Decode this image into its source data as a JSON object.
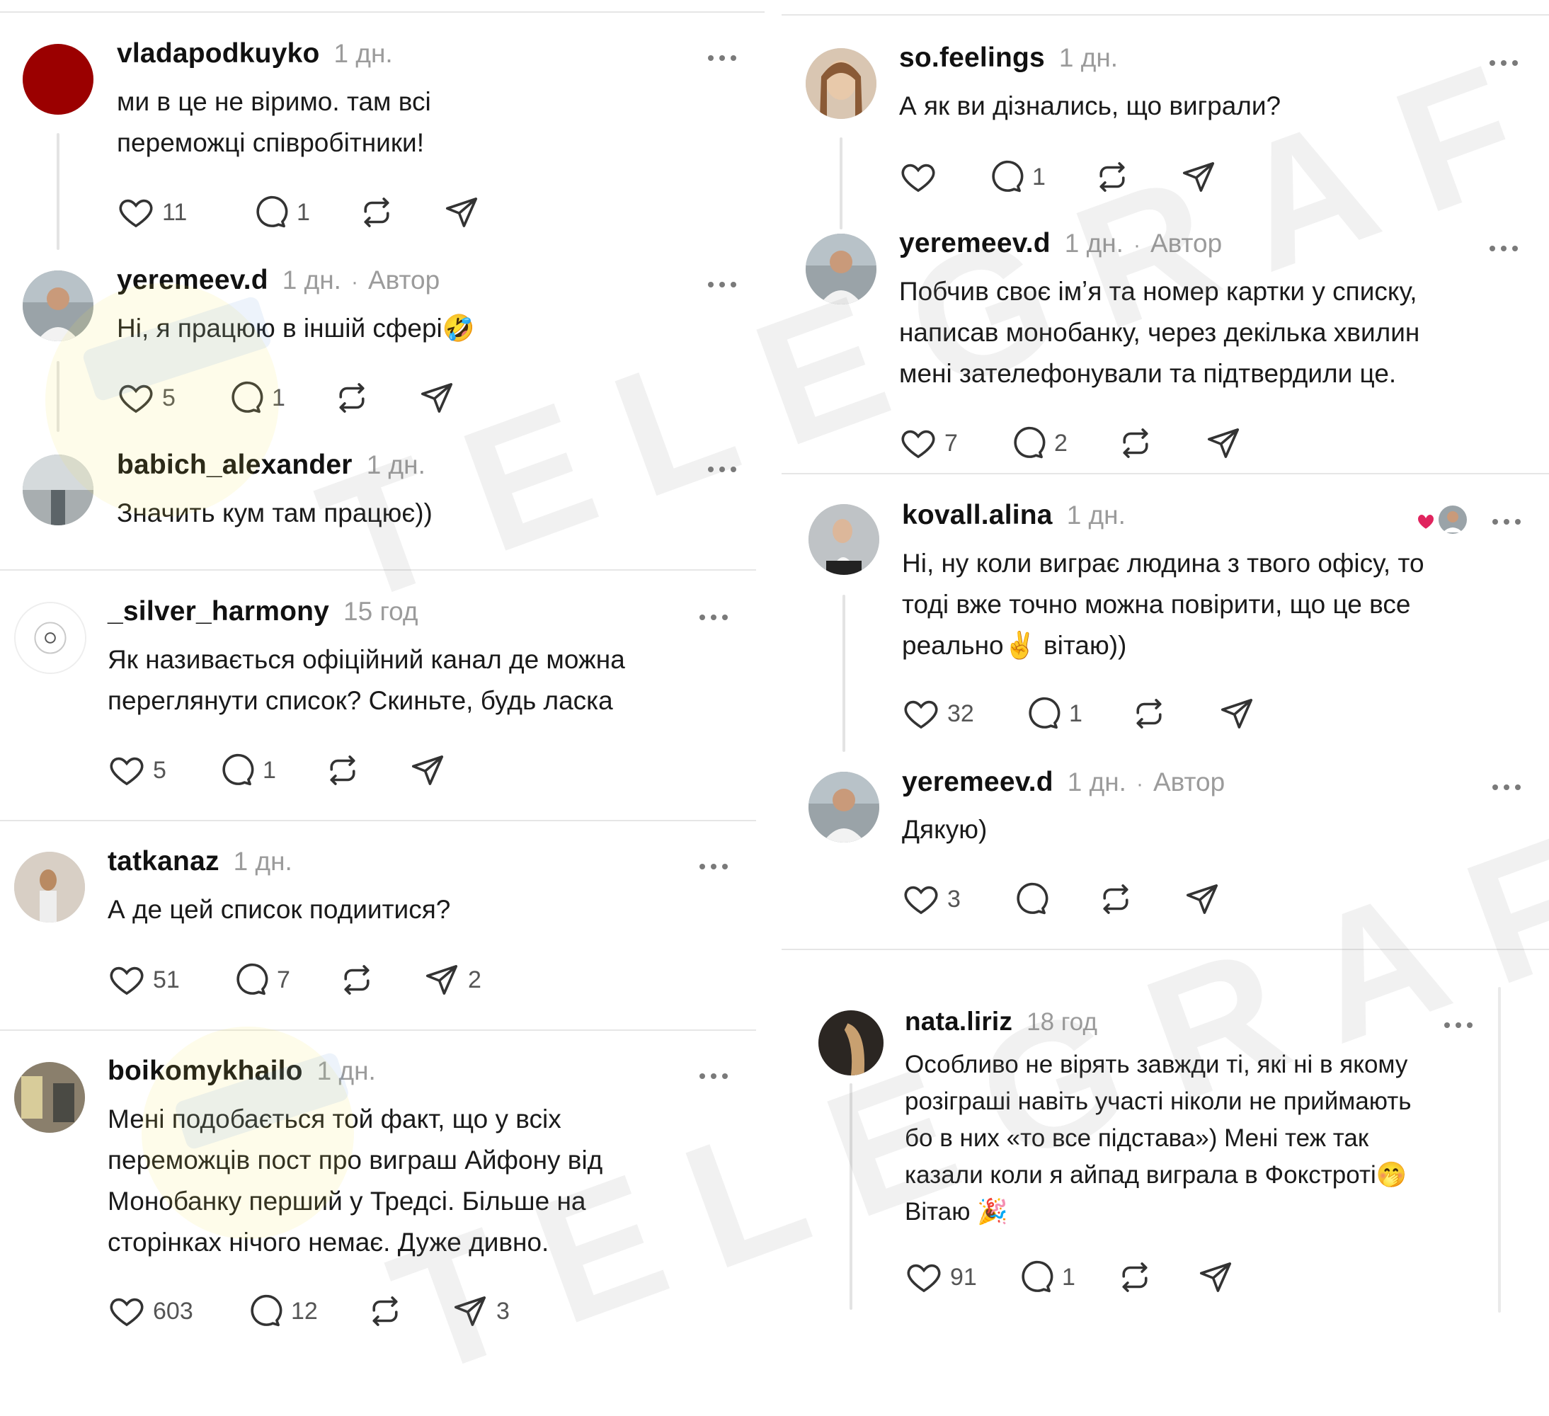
{
  "watermark": {
    "text": "TELEGRAF"
  },
  "icons": {
    "like": "heart-icon",
    "reply": "speech-bubble-icon",
    "repost": "repost-icon",
    "share": "paper-plane-icon",
    "more": "more-dots-icon"
  },
  "colors": {
    "text": "#1a1a1a",
    "muted": "#9b9b9b",
    "divider": "#e6e6e6",
    "heart": "#e0245e"
  },
  "left": [
    {
      "username": "vladapodkuyko",
      "time": "1 дн.",
      "author": "",
      "text": "ми в це не віримо. там всі\nпереможці співробітники!",
      "likes": "11",
      "replies": "1",
      "reposts": "",
      "shares": ""
    },
    {
      "username": "yeremeev.d",
      "time": "1 дн.",
      "author": "Автор",
      "text": "Ні, я працюю в іншій сфері🤣",
      "likes": "5",
      "replies": "1",
      "reposts": "",
      "shares": ""
    },
    {
      "username": "babich_alexander",
      "time": "1 дн.",
      "author": "",
      "text": "Значить кум там працює))",
      "likes": "",
      "replies": "",
      "reposts": "",
      "shares": ""
    },
    {
      "username": "_silver_harmony",
      "time": "15 год",
      "author": "",
      "text": "Як називається офіційний канал де можна\nпереглянути список? Скиньте, будь ласка",
      "likes": "5",
      "replies": "1",
      "reposts": "",
      "shares": ""
    },
    {
      "username": "tatkanaz",
      "time": "1 дн.",
      "author": "",
      "text": "А де цей список подиитися?",
      "likes": "51",
      "replies": "7",
      "reposts": "",
      "shares": "2"
    },
    {
      "username": "boikomykhailo",
      "time": "1 дн.",
      "author": "",
      "text": "Мені подобається той факт, що у всіх\nпереможців пост про виграш Айфону від\nМонобанку перший у Тредсі. Більше на\nсторінках нічого немає. Дуже дивно.",
      "likes": "603",
      "replies": "12",
      "reposts": "",
      "shares": "3"
    }
  ],
  "right": [
    {
      "username": "so.feelings",
      "time": "1 дн.",
      "author": "",
      "text": "А як ви дізнались, що виграли?",
      "likes": "",
      "replies": "1",
      "reposts": "",
      "shares": ""
    },
    {
      "username": "yeremeev.d",
      "time": "1 дн.",
      "author": "Автор",
      "text": "Побчив своє імʼя та номер картки у списку,\nнаписав монобанку, через декілька хвилин\nмені зателефонували та підтвердили це.",
      "likes": "7",
      "replies": "2",
      "reposts": "",
      "shares": ""
    },
    {
      "username": "kovall.alina",
      "time": "1 дн.",
      "author": "",
      "text": "Ні, ну коли виграє людина з твого офісу, то\nтоді вже точно можна повірити, що це все\nреально✌️ вітаю))",
      "likes": "32",
      "replies": "1",
      "reposts": "",
      "shares": ""
    },
    {
      "username": "yeremeev.d",
      "time": "1 дн.",
      "author": "Автор",
      "text": "Дякую)",
      "likes": "3",
      "replies": "",
      "reposts": "",
      "shares": ""
    },
    {
      "username": "nata.liriz",
      "time": "18 год",
      "author": "",
      "text": "Особливо не вірять завжди ті, які ні в якому\nрозіграші навіть участі ніколи не приймають\nбо в них «то все підстава») Мені теж так\nказали коли я айпад виграла в Фокстроті🤭\nВітаю 🎉",
      "likes": "91",
      "replies": "1",
      "reposts": "",
      "shares": ""
    }
  ]
}
